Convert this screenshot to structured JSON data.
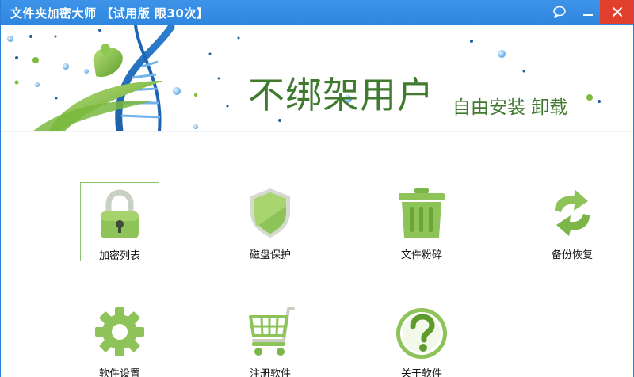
{
  "window": {
    "title": "文件夹加密大师 【试用版 限30次】",
    "titlebar_color": "#2f86de",
    "close_color": "#e2402f"
  },
  "titlebar_buttons": [
    {
      "name": "feedback",
      "icon": "speech-bubble-icon"
    },
    {
      "name": "minimize",
      "icon": "minimize-icon"
    },
    {
      "name": "close",
      "icon": "close-icon"
    }
  ],
  "banner": {
    "slogan": "不绑架用户",
    "subslogan": "自由安装 卸载",
    "accent_color": "#3f7a2f"
  },
  "tiles": [
    {
      "label": "加密列表",
      "icon": "padlock-icon",
      "selected": true
    },
    {
      "label": "磁盘保护",
      "icon": "shield-icon",
      "selected": false
    },
    {
      "label": "文件粉碎",
      "icon": "trash-icon",
      "selected": false
    },
    {
      "label": "备份恢复",
      "icon": "sync-arrows-icon",
      "selected": false
    },
    {
      "label": "软件设置",
      "icon": "gear-icon",
      "selected": false
    },
    {
      "label": "注册软件",
      "icon": "shopping-cart-icon",
      "selected": false
    },
    {
      "label": "关于软件",
      "icon": "question-icon",
      "selected": false
    }
  ]
}
